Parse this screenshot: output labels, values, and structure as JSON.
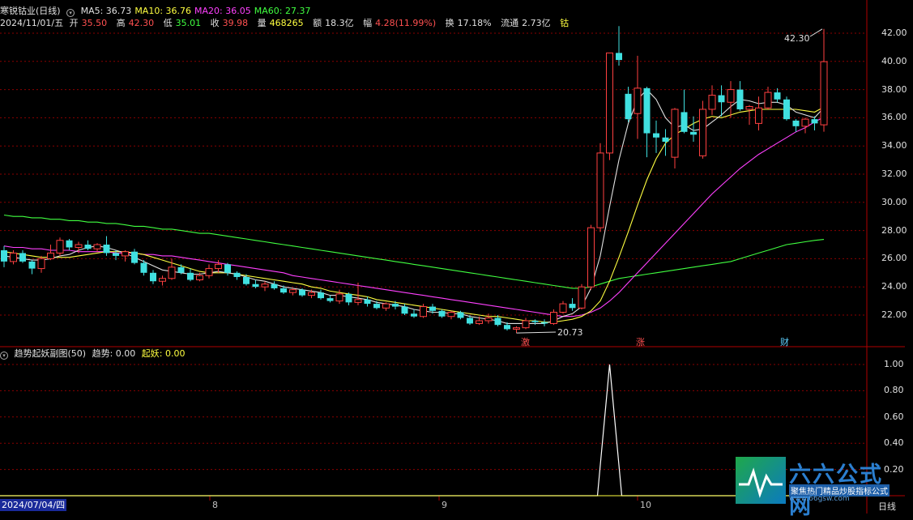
{
  "stock": {
    "name": "寒锐钴业",
    "period_tag": "(日线)",
    "ma_labels": [
      {
        "text": "MA5: 36.73",
        "color": "#e0e0e0"
      },
      {
        "text": "MA10: 36.76",
        "color": "#ffff40"
      },
      {
        "text": "MA20: 36.05",
        "color": "#ff40ff"
      },
      {
        "text": "MA60: 27.37",
        "color": "#40ff40"
      }
    ]
  },
  "quote": {
    "date": "2024/11/01/五",
    "open_label": "开",
    "open": "35.50",
    "high_label": "高",
    "high": "42.30",
    "low_label": "低",
    "low": "35.01",
    "close_label": "收",
    "close": "39.98",
    "vol_label": "量",
    "vol": "468265",
    "amount_label": "额",
    "amount": "18.3亿",
    "change_label": "幅",
    "change": "4.28(11.99%)",
    "turnover_label": "换",
    "turnover": "17.18%",
    "float_label": "流通",
    "float": "2.73亿",
    "sector": "钴"
  },
  "sub_panel": {
    "name": "趋势起妖副图(50)",
    "trend_label": "趋势: 0.00",
    "yao_label": "起妖: 0.00"
  },
  "annotations": {
    "high": "42.30",
    "low": "20.73"
  },
  "events": {
    "e1": "激",
    "e2": "涨",
    "e3": "财"
  },
  "axis": {
    "price_ticks": [
      "42.00",
      "40.00",
      "38.00",
      "36.00",
      "34.00",
      "32.00",
      "30.00",
      "28.00",
      "26.00",
      "24.00",
      "22.00"
    ],
    "sub_ticks": [
      "1.00",
      "0.80",
      "0.60",
      "0.40",
      "0.20"
    ],
    "start_date": "2024/07/04/四",
    "month_labels": [
      "8",
      "9",
      "10"
    ]
  },
  "period_button": "日线",
  "brand": {
    "name": "六六公式网",
    "slogan": "聚焦热门精品炒股指标公式",
    "url": "www.66gsw.com"
  },
  "colors": {
    "up": "#ff4040",
    "down": "#40e0e0",
    "ma5": "#e0e0e0",
    "ma10": "#ffff40",
    "ma20": "#ff40ff",
    "ma60": "#40ff40",
    "grid": "#8b0000"
  },
  "chart_data": {
    "type": "candlestick",
    "price_ylim": [
      20.5,
      43.0
    ],
    "sub_ylim": [
      0,
      1.05
    ],
    "candles": [
      [
        26.6,
        26.9,
        25.4,
        25.8
      ],
      [
        25.8,
        26.6,
        25.6,
        26.4
      ],
      [
        26.4,
        26.6,
        25.7,
        25.8
      ],
      [
        25.8,
        25.9,
        24.9,
        25.3
      ],
      [
        25.3,
        26.2,
        25.0,
        26.0
      ],
      [
        26.0,
        27.0,
        25.9,
        26.4
      ],
      [
        26.4,
        27.5,
        26.2,
        27.3
      ],
      [
        27.3,
        27.4,
        26.6,
        26.8
      ],
      [
        26.8,
        27.2,
        26.4,
        27.0
      ],
      [
        27.0,
        27.3,
        26.6,
        26.7
      ],
      [
        26.7,
        27.1,
        26.5,
        27.0
      ],
      [
        27.0,
        27.6,
        26.2,
        26.4
      ],
      [
        26.4,
        26.6,
        25.9,
        26.2
      ],
      [
        26.2,
        26.6,
        25.8,
        26.5
      ],
      [
        26.5,
        26.7,
        25.6,
        25.7
      ],
      [
        25.7,
        25.9,
        24.8,
        25.0
      ],
      [
        25.0,
        25.2,
        24.2,
        24.4
      ],
      [
        24.4,
        24.8,
        24.1,
        24.6
      ],
      [
        24.6,
        26.0,
        24.5,
        25.4
      ],
      [
        25.4,
        25.6,
        24.9,
        25.0
      ],
      [
        25.0,
        25.3,
        24.4,
        24.5
      ],
      [
        24.5,
        25.0,
        24.4,
        24.8
      ],
      [
        24.8,
        25.6,
        24.6,
        25.3
      ],
      [
        25.3,
        25.9,
        25.0,
        25.6
      ],
      [
        25.6,
        25.7,
        24.8,
        25.0
      ],
      [
        25.0,
        25.1,
        24.5,
        24.7
      ],
      [
        24.7,
        24.9,
        24.1,
        24.2
      ],
      [
        24.2,
        24.5,
        23.9,
        24.0
      ],
      [
        24.0,
        24.4,
        23.7,
        24.2
      ],
      [
        24.2,
        24.4,
        23.8,
        23.9
      ],
      [
        23.9,
        24.1,
        23.5,
        23.6
      ],
      [
        23.6,
        23.9,
        23.4,
        23.8
      ],
      [
        23.8,
        23.9,
        23.3,
        23.4
      ],
      [
        23.4,
        23.8,
        23.2,
        23.6
      ],
      [
        23.6,
        23.8,
        23.1,
        23.2
      ],
      [
        23.2,
        23.4,
        22.9,
        23.0
      ],
      [
        23.0,
        23.8,
        22.8,
        23.5
      ],
      [
        23.5,
        23.6,
        22.7,
        22.9
      ],
      [
        22.9,
        24.3,
        22.7,
        23.1
      ],
      [
        23.1,
        23.3,
        22.6,
        22.8
      ],
      [
        22.8,
        23.0,
        22.4,
        22.5
      ],
      [
        22.5,
        22.9,
        22.3,
        22.8
      ],
      [
        22.8,
        23.0,
        22.4,
        22.6
      ],
      [
        22.6,
        22.8,
        22.0,
        22.1
      ],
      [
        22.1,
        22.4,
        21.8,
        21.9
      ],
      [
        21.9,
        22.8,
        21.8,
        22.6
      ],
      [
        22.6,
        22.8,
        22.1,
        22.3
      ],
      [
        22.3,
        22.4,
        21.8,
        21.9
      ],
      [
        21.9,
        22.3,
        21.7,
        22.2
      ],
      [
        22.2,
        22.3,
        21.7,
        21.8
      ],
      [
        21.8,
        22.0,
        21.3,
        21.4
      ],
      [
        21.4,
        21.9,
        21.3,
        21.6
      ],
      [
        21.6,
        22.1,
        21.4,
        21.8
      ],
      [
        21.8,
        22.0,
        21.2,
        21.3
      ],
      [
        21.3,
        21.5,
        20.9,
        21.0
      ],
      [
        21.0,
        21.2,
        20.73,
        21.1
      ],
      [
        21.1,
        21.8,
        21.0,
        21.6
      ],
      [
        21.6,
        21.7,
        21.3,
        21.5
      ],
      [
        21.5,
        21.7,
        21.2,
        21.4
      ],
      [
        21.4,
        22.4,
        21.3,
        22.2
      ],
      [
        22.2,
        23.0,
        22.1,
        22.8
      ],
      [
        22.8,
        23.2,
        22.3,
        22.5
      ],
      [
        22.5,
        24.2,
        22.4,
        24.0
      ],
      [
        24.0,
        28.4,
        23.8,
        28.2
      ],
      [
        28.2,
        34.2,
        27.9,
        33.5
      ],
      [
        33.5,
        40.6,
        33.0,
        40.6
      ],
      [
        40.6,
        42.5,
        39.7,
        40.1
      ],
      [
        37.7,
        38.2,
        35.7,
        35.9
      ],
      [
        36.3,
        40.4,
        34.5,
        38.1
      ],
      [
        38.1,
        38.2,
        33.2,
        34.9
      ],
      [
        34.9,
        35.8,
        33.5,
        34.6
      ],
      [
        34.6,
        35.2,
        33.3,
        34.3
      ],
      [
        33.2,
        36.7,
        32.4,
        36.6
      ],
      [
        36.4,
        38.0,
        34.9,
        35.0
      ],
      [
        35.0,
        36.1,
        34.3,
        34.8
      ],
      [
        33.3,
        37.2,
        33.1,
        36.6
      ],
      [
        36.6,
        38.3,
        36.2,
        37.6
      ],
      [
        37.6,
        38.3,
        36.1,
        37.1
      ],
      [
        37.1,
        38.6,
        36.0,
        38.0
      ],
      [
        38.0,
        38.6,
        36.5,
        36.6
      ],
      [
        36.6,
        36.9,
        35.5,
        36.8
      ],
      [
        35.6,
        37.5,
        35.1,
        36.7
      ],
      [
        36.7,
        38.2,
        36.6,
        37.8
      ],
      [
        37.8,
        38.1,
        37.1,
        37.3
      ],
      [
        37.3,
        37.5,
        35.8,
        35.9
      ],
      [
        35.8,
        35.9,
        35.0,
        35.4
      ],
      [
        35.4,
        36.0,
        34.9,
        35.9
      ],
      [
        35.9,
        36.1,
        35.1,
        35.6
      ],
      [
        35.5,
        42.3,
        35.01,
        39.98
      ]
    ],
    "ma5": [
      26.2,
      26.1,
      26.0,
      25.9,
      25.9,
      26.0,
      26.2,
      26.3,
      26.6,
      26.8,
      26.9,
      26.8,
      26.6,
      26.4,
      26.1,
      25.8,
      25.5,
      25.2,
      25.1,
      25.0,
      24.9,
      24.9,
      25.0,
      25.1,
      25.0,
      24.9,
      24.7,
      24.5,
      24.4,
      24.2,
      24.0,
      23.9,
      23.8,
      23.7,
      23.6,
      23.4,
      23.4,
      23.3,
      23.2,
      23.1,
      22.9,
      22.8,
      22.7,
      22.6,
      22.4,
      22.3,
      22.2,
      22.2,
      22.1,
      22.1,
      21.9,
      21.8,
      21.7,
      21.6,
      21.4,
      21.4,
      21.4,
      21.4,
      21.4,
      21.6,
      21.9,
      22.1,
      22.6,
      23.9,
      26.2,
      29.7,
      33.0,
      35.6,
      37.3,
      38.0,
      37.3,
      36.0,
      35.3,
      35.5,
      35.1,
      35.2,
      35.7,
      36.2,
      36.8,
      37.3,
      37.2,
      37.0,
      37.1,
      37.1,
      36.9,
      36.4,
      36.2,
      36.0,
      36.73
    ],
    "ma10": [
      26.5,
      26.4,
      26.3,
      26.2,
      26.1,
      26.1,
      26.1,
      26.1,
      26.2,
      26.3,
      26.4,
      26.5,
      26.5,
      26.5,
      26.4,
      26.3,
      26.1,
      25.9,
      25.7,
      25.5,
      25.3,
      25.1,
      25.0,
      25.0,
      25.0,
      24.9,
      24.8,
      24.7,
      24.6,
      24.5,
      24.4,
      24.3,
      24.2,
      24.0,
      23.9,
      23.7,
      23.6,
      23.5,
      23.4,
      23.3,
      23.1,
      23.0,
      22.9,
      22.8,
      22.7,
      22.6,
      22.5,
      22.4,
      22.3,
      22.2,
      22.1,
      22.0,
      21.9,
      21.9,
      21.8,
      21.7,
      21.6,
      21.6,
      21.5,
      21.5,
      21.6,
      21.7,
      21.9,
      22.3,
      23.0,
      24.4,
      26.1,
      27.9,
      29.8,
      31.6,
      33.1,
      34.2,
      34.8,
      35.2,
      35.6,
      35.9,
      36.1,
      36.0,
      36.2,
      36.4,
      36.5,
      36.6,
      36.6,
      36.6,
      36.6,
      36.6,
      36.5,
      36.4,
      36.76
    ],
    "ma20": [
      26.9,
      26.8,
      26.8,
      26.7,
      26.7,
      26.6,
      26.6,
      26.6,
      26.5,
      26.5,
      26.5,
      26.5,
      26.4,
      26.4,
      26.4,
      26.3,
      26.3,
      26.2,
      26.2,
      26.1,
      26.0,
      25.9,
      25.8,
      25.7,
      25.6,
      25.5,
      25.4,
      25.3,
      25.2,
      25.1,
      25.0,
      24.8,
      24.7,
      24.6,
      24.5,
      24.4,
      24.3,
      24.2,
      24.1,
      24.0,
      23.9,
      23.8,
      23.7,
      23.6,
      23.5,
      23.4,
      23.3,
      23.2,
      23.1,
      23.0,
      22.9,
      22.8,
      22.7,
      22.6,
      22.5,
      22.4,
      22.3,
      22.2,
      22.1,
      22.0,
      21.9,
      21.9,
      22.0,
      22.2,
      22.5,
      23.0,
      23.6,
      24.3,
      25.0,
      25.7,
      26.4,
      27.1,
      27.8,
      28.5,
      29.2,
      29.9,
      30.6,
      31.2,
      31.8,
      32.4,
      32.9,
      33.4,
      33.8,
      34.2,
      34.6,
      35.0,
      35.3,
      35.7,
      36.05
    ],
    "ma60": [
      29.1,
      29.0,
      29.0,
      28.9,
      28.9,
      28.8,
      28.8,
      28.7,
      28.7,
      28.6,
      28.6,
      28.5,
      28.5,
      28.4,
      28.3,
      28.3,
      28.2,
      28.1,
      28.1,
      28.0,
      27.9,
      27.8,
      27.8,
      27.7,
      27.6,
      27.5,
      27.4,
      27.3,
      27.2,
      27.1,
      27.0,
      26.9,
      26.8,
      26.7,
      26.6,
      26.5,
      26.4,
      26.3,
      26.2,
      26.1,
      26.0,
      25.9,
      25.8,
      25.7,
      25.6,
      25.5,
      25.4,
      25.3,
      25.2,
      25.1,
      25.0,
      24.9,
      24.8,
      24.7,
      24.6,
      24.5,
      24.4,
      24.3,
      24.2,
      24.1,
      24.0,
      23.9,
      23.9,
      24.0,
      24.2,
      24.4,
      24.6,
      24.7,
      24.8,
      24.9,
      25.0,
      25.1,
      25.2,
      25.3,
      25.4,
      25.5,
      25.6,
      25.7,
      25.8,
      26.0,
      26.2,
      26.4,
      26.6,
      26.8,
      27.0,
      27.1,
      27.2,
      27.3,
      27.37
    ],
    "sub_series": {
      "name": "趋势",
      "peak_index": 65,
      "peak_value": 1.0
    }
  }
}
